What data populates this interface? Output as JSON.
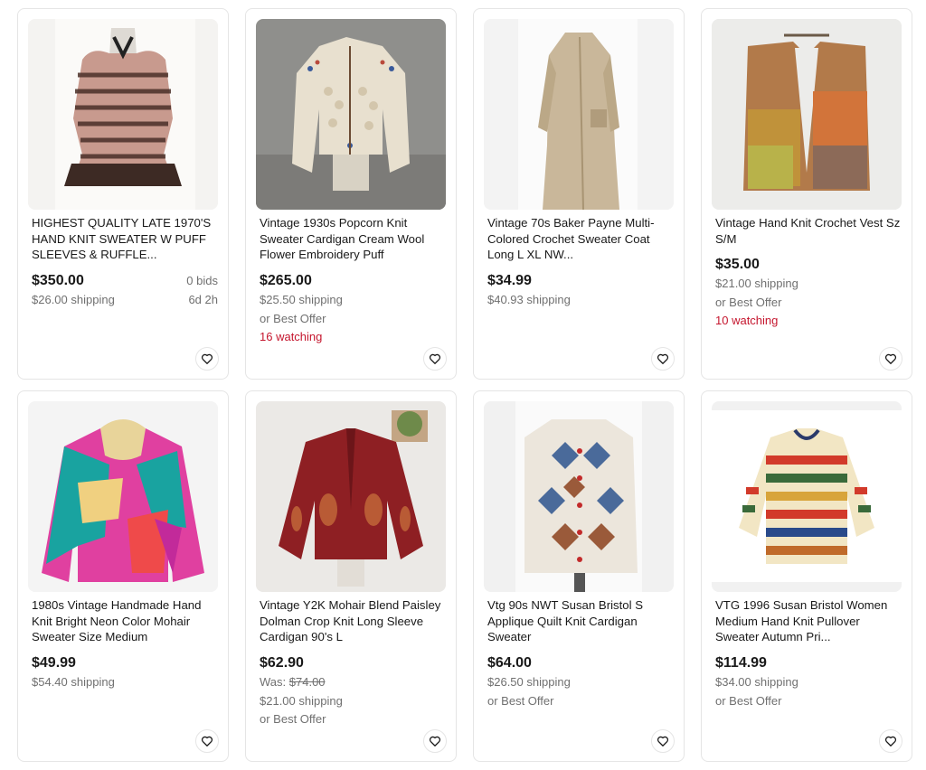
{
  "listings": [
    {
      "title": "HIGHEST QUALITY LATE 1970'S HAND KNIT SWEATER W PUFF SLEEVES & RUFFLE...",
      "price": "$350.00",
      "bids": "0 bids",
      "shipping": "$26.00 shipping",
      "time_left": "6d 2h",
      "image_label": "Brown and pink puff sleeve knit sweater on mannequin"
    },
    {
      "title": "Vintage 1930s Popcorn Knit Sweater Cardigan Cream Wool Flower Embroidery Puff",
      "price": "$265.00",
      "shipping": "$25.50 shipping",
      "best_offer": "or Best Offer",
      "watching": "16 watching",
      "image_label": "Cream popcorn knit cardigan with flower embroidery"
    },
    {
      "title": "Vintage 70s Baker Payne Multi-Colored Crochet Sweater Coat Long L XL NW...",
      "price": "$34.99",
      "shipping": "$40.93 shipping",
      "image_label": "Long beige crochet sweater coat"
    },
    {
      "title": "Vintage Hand Knit Crochet Vest Sz S/M",
      "price": "$35.00",
      "shipping": "$21.00 shipping",
      "best_offer": "or Best Offer",
      "watching": "10 watching",
      "image_label": "Multicolor hand knit crochet vest on hanger"
    },
    {
      "title": "1980s Vintage Handmade Hand Knit Bright Neon Color Mohair Sweater Size Medium",
      "price": "$49.99",
      "shipping": "$54.40 shipping",
      "image_label": "Neon color block mohair sweater"
    },
    {
      "title": "Vintage Y2K Mohair Blend Paisley Dolman Crop Knit Long Sleeve Cardigan 90's L",
      "price": "$62.90",
      "was_label": "Was:",
      "was_price": "$74.00",
      "shipping": "$21.00 shipping",
      "best_offer": "or Best Offer",
      "image_label": "Red paisley mohair crop cardigan"
    },
    {
      "title": "Vtg 90s NWT Susan Bristol S Applique Quilt Knit Cardigan Sweater",
      "price": "$64.00",
      "shipping": "$26.50 shipping",
      "best_offer": "or Best Offer",
      "image_label": "White knit cardigan with quilt applique"
    },
    {
      "title": "VTG 1996 Susan Bristol Women Medium Hand Knit Pullover Sweater Autumn Pri...",
      "price": "$114.99",
      "shipping": "$34.00 shipping",
      "best_offer": "or Best Offer",
      "image_label": "Autumn print hand knit pullover sweater"
    }
  ],
  "icons": {
    "watch": "heart-icon"
  },
  "colors": {
    "watching": "#c5162e",
    "muted": "#707070",
    "text": "#191919"
  }
}
